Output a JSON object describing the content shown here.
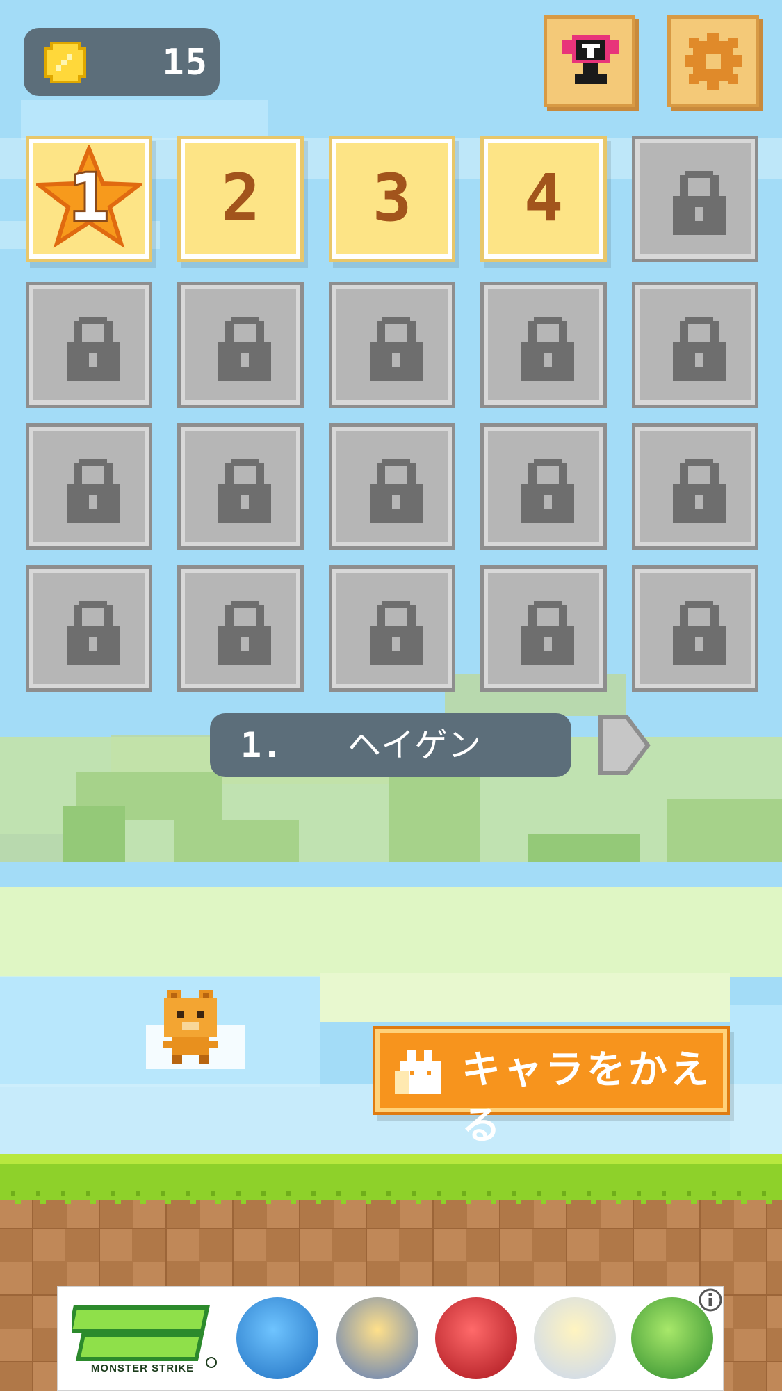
{
  "hud": {
    "coin_count": "15",
    "coin_icon": "coin-icon",
    "trophy_icon": "trophy-icon",
    "settings_icon": "gear-icon"
  },
  "levels": [
    {
      "label": "1",
      "state": "cleared-star"
    },
    {
      "label": "2",
      "state": "unlocked"
    },
    {
      "label": "3",
      "state": "unlocked"
    },
    {
      "label": "4",
      "state": "unlocked"
    },
    {
      "label": "",
      "state": "locked"
    },
    {
      "label": "",
      "state": "locked"
    },
    {
      "label": "",
      "state": "locked"
    },
    {
      "label": "",
      "state": "locked"
    },
    {
      "label": "",
      "state": "locked"
    },
    {
      "label": "",
      "state": "locked"
    },
    {
      "label": "",
      "state": "locked"
    },
    {
      "label": "",
      "state": "locked"
    },
    {
      "label": "",
      "state": "locked"
    },
    {
      "label": "",
      "state": "locked"
    },
    {
      "label": "",
      "state": "locked"
    },
    {
      "label": "",
      "state": "locked"
    },
    {
      "label": "",
      "state": "locked"
    },
    {
      "label": "",
      "state": "locked"
    },
    {
      "label": "",
      "state": "locked"
    },
    {
      "label": "",
      "state": "locked"
    }
  ],
  "stage": {
    "number": "1.",
    "name": "ヘイゲン",
    "next_icon": "chevron-right-icon"
  },
  "character_button": {
    "label": "キャラをかえる",
    "icon": "rabbit-icon"
  },
  "ad": {
    "brand_sub": "MONSTER STRIKE",
    "info_icon": "info-icon"
  },
  "colors": {
    "sky": "#a3dcf7",
    "panel": "#5c6e7a",
    "tile_open": "#fde486",
    "tile_locked": "#b6b6b6",
    "accent_orange": "#f7941d",
    "grass": "#8ed12a",
    "dirt": "#b07848"
  }
}
